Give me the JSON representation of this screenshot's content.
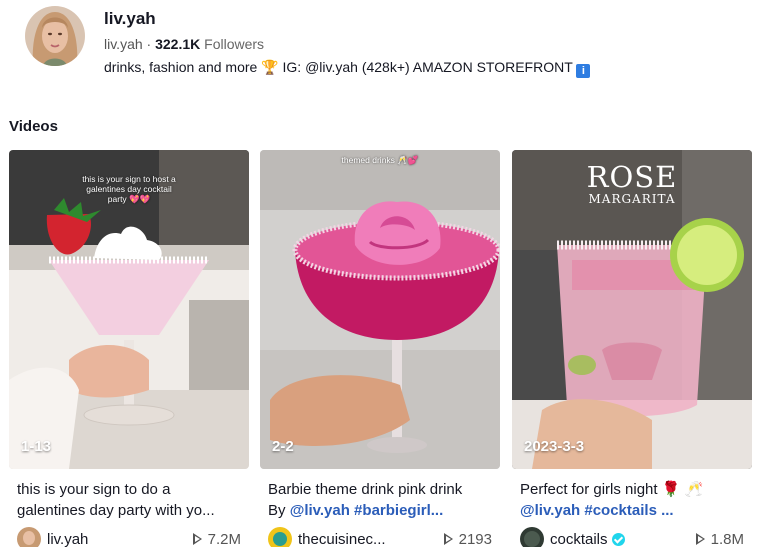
{
  "profile": {
    "name": "liv.yah",
    "handle": "liv.yah",
    "separator": "·",
    "followers_count": "322.1K",
    "followers_label": "Followers",
    "bio": "drinks, fashion and more 🏆 IG: @liv.yah (428k+) AMAZON STOREFRONT",
    "bio_badge": "i"
  },
  "section": {
    "title": "Videos"
  },
  "videos": [
    {
      "tag": "1-13",
      "overlay": "this is your sign to host a galentines day cocktail party 💖💖",
      "caption_line1": "this is your sign to do a",
      "caption_line2": "galentines day party with yo...",
      "author": "liv.yah",
      "plays": "7.2M"
    },
    {
      "tag": "2-2",
      "overlay": "themed drinks 🥂💕",
      "caption_line1": "Barbie theme drink pink drink",
      "caption_by": "By",
      "caption_tags": "@liv.yah #barbiegirl...",
      "author": "thecuisinec...",
      "plays": "2193"
    },
    {
      "tag": "2023-3-3",
      "overlay_title": "ROSE",
      "overlay_subtitle": "MARGARITA",
      "caption_line1": "Perfect for girls night 🌹 🥂",
      "caption_tags": "@liv.yah #cocktails ...",
      "author": "cocktails",
      "plays": "1.8M"
    }
  ],
  "colors": {
    "link": "#2b5db9",
    "verified": "#20d5ec",
    "badge": "#2f7de1"
  },
  "icons": [
    "play-icon",
    "verified-icon",
    "info-badge-icon"
  ]
}
